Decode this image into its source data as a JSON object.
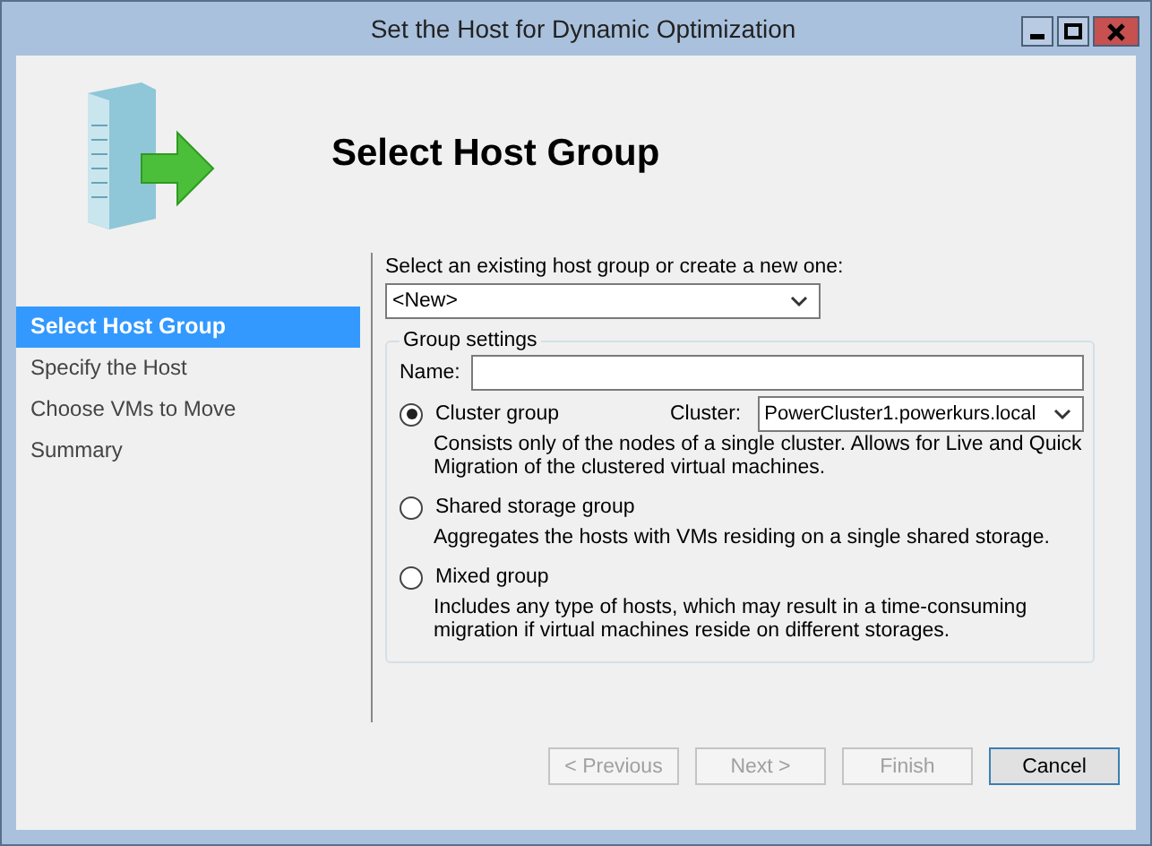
{
  "window": {
    "title": "Set the Host for Dynamic Optimization"
  },
  "header": {
    "title": "Select Host Group"
  },
  "steps": [
    {
      "label": "Select Host Group",
      "selected": true
    },
    {
      "label": "Specify the Host",
      "selected": false
    },
    {
      "label": "Choose VMs to Move",
      "selected": false
    },
    {
      "label": "Summary",
      "selected": false
    }
  ],
  "host_group": {
    "label": "Select an existing host group or create a new one:",
    "value": "<New>"
  },
  "group_settings": {
    "legend": "Group settings",
    "name_label": "Name:",
    "options": [
      {
        "label": "Cluster group",
        "selected": true,
        "description": "Consists only of the nodes of a single cluster. Allows for Live and Quick Migration of the clustered virtual machines.",
        "cluster": {
          "label": "Cluster:",
          "value": "PowerCluster1.powerkurs.local"
        }
      },
      {
        "label": "Shared storage group",
        "selected": false,
        "description": "Aggregates the hosts with VMs residing on a single shared storage."
      },
      {
        "label": "Mixed group",
        "selected": false,
        "description": "Includes any type of hosts, which may result in a time-consuming migration if virtual machines reside on different storages."
      }
    ]
  },
  "buttons": [
    {
      "label": "< Previous",
      "disabled": true,
      "default": false
    },
    {
      "label": "Next >",
      "disabled": true,
      "default": false
    },
    {
      "label": "Finish",
      "disabled": true,
      "default": false
    },
    {
      "label": "Cancel",
      "disabled": false,
      "default": true
    }
  ]
}
